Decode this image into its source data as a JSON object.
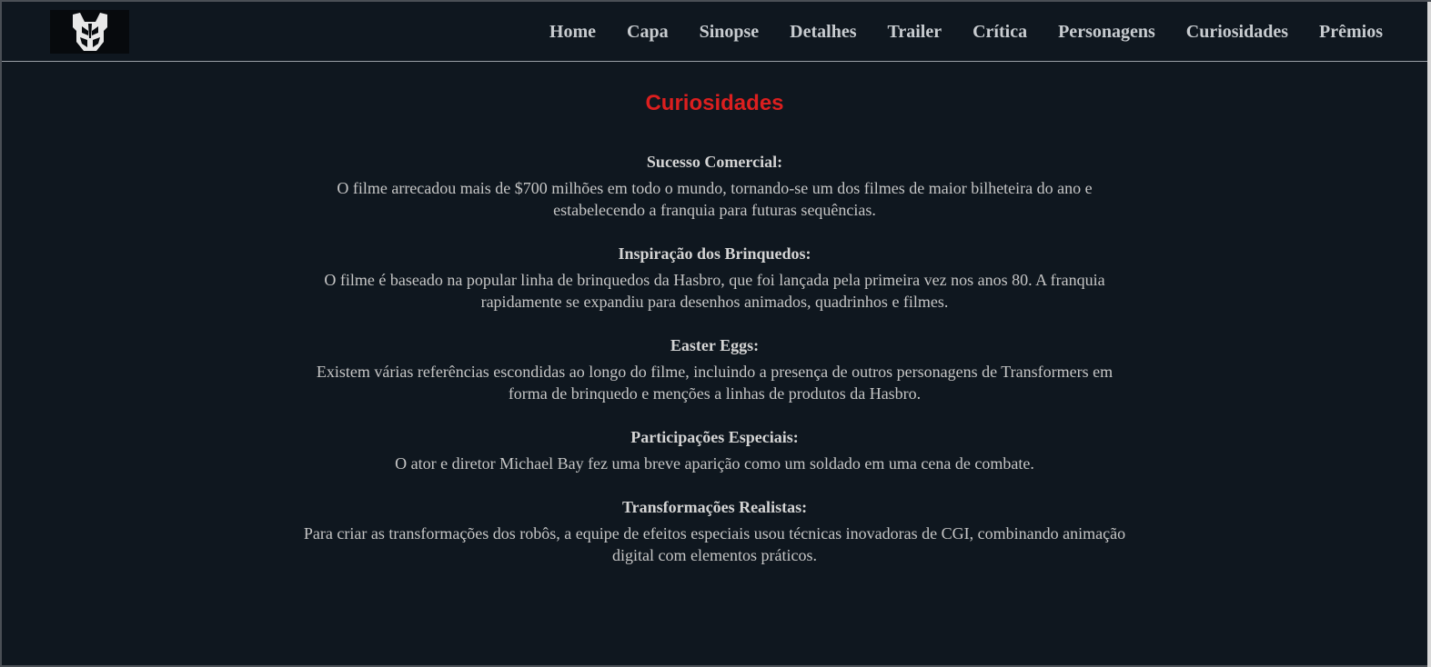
{
  "header": {
    "logo_icon": "autobot-insignia-icon",
    "nav": [
      {
        "label": "Home"
      },
      {
        "label": "Capa"
      },
      {
        "label": "Sinopse"
      },
      {
        "label": "Detalhes"
      },
      {
        "label": "Trailer"
      },
      {
        "label": "Crítica"
      },
      {
        "label": "Personagens"
      },
      {
        "label": "Curiosidades"
      },
      {
        "label": "Prêmios"
      }
    ]
  },
  "main": {
    "title": "Curiosidades",
    "items": [
      {
        "heading": "Sucesso Comercial:",
        "text": "O filme arrecadou mais de $700 milhões em todo o mundo, tornando-se um dos filmes de maior bilheteira do ano e estabelecendo a franquia para futuras sequências."
      },
      {
        "heading": "Inspiração dos Brinquedos:",
        "text": "O filme é baseado na popular linha de brinquedos da Hasbro, que foi lançada pela primeira vez nos anos 80. A franquia rapidamente se expandiu para desenhos animados, quadrinhos e filmes."
      },
      {
        "heading": "Easter Eggs:",
        "text": "Existem várias referências escondidas ao longo do filme, incluindo a presença de outros personagens de Transformers em forma de brinquedo e menções a linhas de produtos da Hasbro."
      },
      {
        "heading": "Participações Especiais:",
        "text": "O ator e diretor Michael Bay fez uma breve aparição como um soldado em uma cena de combate."
      },
      {
        "heading": "Transformações Realistas:",
        "text": "Para criar as transformações dos robôs, a equipe de efeitos especiais usou técnicas inovadoras de CGI, combinando animação digital com elementos práticos."
      }
    ]
  },
  "colors": {
    "background": "#0f171f",
    "title": "#dc1f1f",
    "text": "#c8c8c8"
  }
}
